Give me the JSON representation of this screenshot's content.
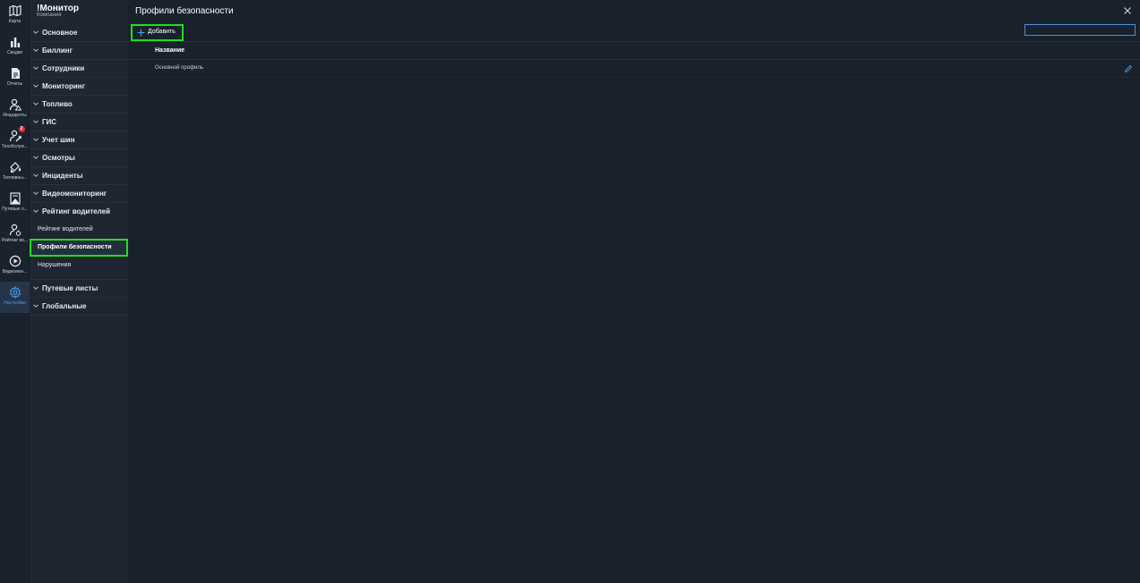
{
  "colors": {
    "accent": "#4d9be6",
    "highlight": "#1ee01e",
    "badge": "#e03131",
    "background": "#18212c"
  },
  "rail": {
    "items": [
      {
        "icon": "map-icon",
        "label": "Карта",
        "active": false
      },
      {
        "icon": "bar-chart-icon",
        "label": "Сводки",
        "active": false
      },
      {
        "icon": "document-icon",
        "label": "Отчеты",
        "active": false
      },
      {
        "icon": "incident-user-icon",
        "label": "Инциденты",
        "active": false
      },
      {
        "icon": "service-user-icon",
        "label": "Техобслуж...",
        "badge": "2",
        "active": false
      },
      {
        "icon": "fuel-icon",
        "label": "Топливны...",
        "active": false
      },
      {
        "icon": "waybill-icon",
        "label": "Путевые л...",
        "active": false
      },
      {
        "icon": "driver-rating-icon",
        "label": "Рейтинг во...",
        "active": false
      },
      {
        "icon": "play-circle-icon",
        "label": "Видеомон...",
        "active": false
      },
      {
        "icon": "gear-icon",
        "label": "Настройки",
        "active": true
      }
    ]
  },
  "tree": {
    "app_title": "!Монитор",
    "app_subtitle": "Компания",
    "groups_top": [
      "Основное",
      "Биллинг",
      "Сотрудники",
      "Мониторинг",
      "Топливо",
      "ГИС",
      "Учет шин",
      "Осмотры",
      "Инциденты",
      "Видеомониторинг",
      "Рейтинг водителей"
    ],
    "sub_items": [
      "Рейтинг водителей",
      "Профили безопасности",
      "Нарушения"
    ],
    "groups_bottom": [
      "Путевые листы",
      "Глобальные"
    ]
  },
  "main": {
    "title": "Профили безопасности",
    "add_label": "Добавить",
    "search_value": "",
    "table": {
      "columns": [
        "Название"
      ],
      "rows": [
        [
          "Основной профиль"
        ]
      ]
    }
  }
}
